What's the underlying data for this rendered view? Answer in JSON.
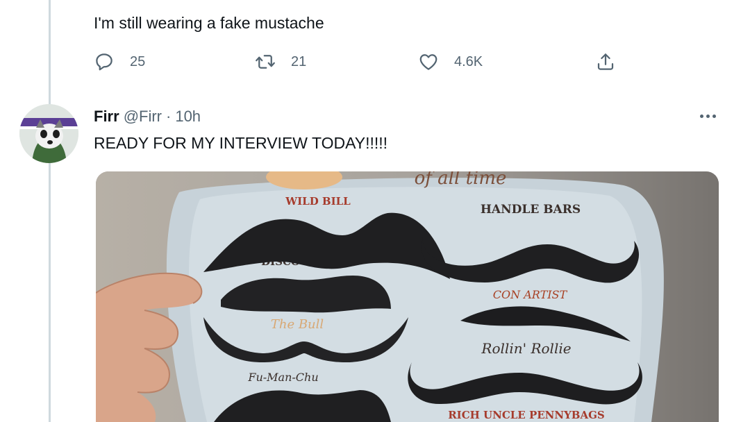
{
  "previous_tweet": {
    "text": "I'm still wearing a fake mustache",
    "reply_count": "25",
    "retweet_count": "21",
    "like_count": "4.6K"
  },
  "tweet": {
    "display_name": "Firr",
    "handle": "@Firr",
    "separator": "·",
    "time": "10h",
    "text": "READY FOR MY INTERVIEW TODAY!!!!!",
    "media": {
      "header_text": "of all time",
      "mustache_labels": [
        "WILD BILL",
        "HANDLE BARS",
        "DISCO DAVE",
        "CON ARTIST",
        "The Bull",
        "Rollin' Rollie",
        "Fu-Man-Chu",
        "RICH UNCLE PENNYBAGS"
      ]
    }
  },
  "colors": {
    "text_primary": "#0f1419",
    "text_secondary": "#536471",
    "thread_line": "#cfd9de"
  }
}
